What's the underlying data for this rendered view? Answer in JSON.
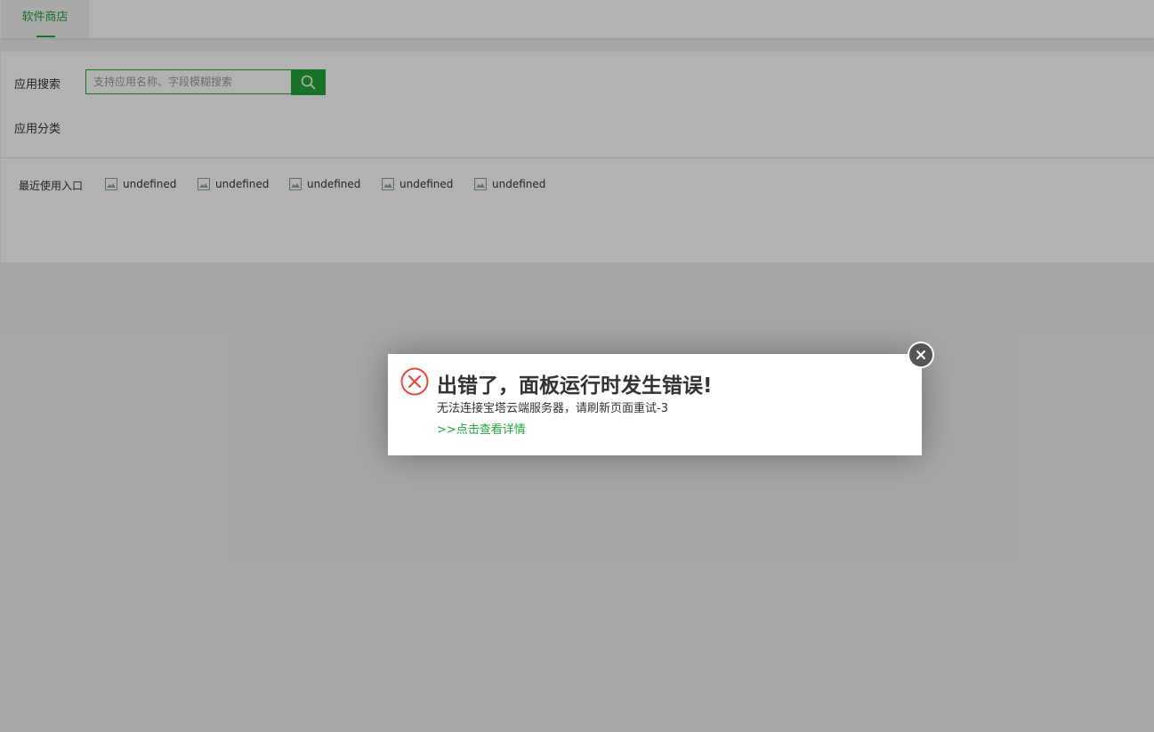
{
  "tabs": [
    {
      "label": "软件商店",
      "active": true
    }
  ],
  "search": {
    "label": "应用搜索",
    "placeholder": "支持应用名称、字段模糊搜索",
    "value": ""
  },
  "category": {
    "label": "应用分类"
  },
  "recent": {
    "label": "最近使用入口",
    "items": [
      {
        "label": "undefined"
      },
      {
        "label": "undefined"
      },
      {
        "label": "undefined"
      },
      {
        "label": "undefined"
      },
      {
        "label": "undefined"
      }
    ]
  },
  "dialog": {
    "title": "出错了，面板运行时发生错误!",
    "message": "无法连接宝塔云端服务器，请刷新页面重试-3",
    "link": ">>点击查看详情",
    "icon": "error-circle-icon"
  },
  "colors": {
    "accent": "#20a53a",
    "error": "#e34b3c",
    "overlay": "rgba(0,0,0,0.3)"
  }
}
